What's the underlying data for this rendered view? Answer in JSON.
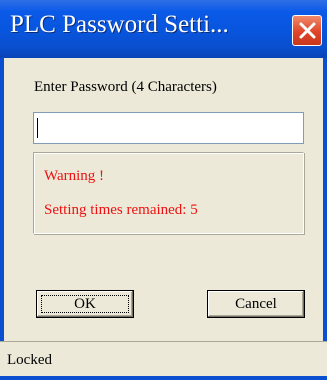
{
  "window": {
    "title": "PLC Password Setti...",
    "close_icon": "close-x-icon"
  },
  "form": {
    "prompt_label": "Enter Password (4 Characters)",
    "password_value": "",
    "password_placeholder": ""
  },
  "warning": {
    "heading": "Warning !",
    "message": "Setting times remained: 5",
    "color": "#ee1111"
  },
  "buttons": {
    "ok_label": "OK",
    "cancel_label": "Cancel"
  },
  "status": {
    "text": "Locked"
  },
  "colors": {
    "titlebar": "#0a5ae8",
    "close_button": "#e0452a",
    "dialog_bg": "#ece9d8"
  }
}
